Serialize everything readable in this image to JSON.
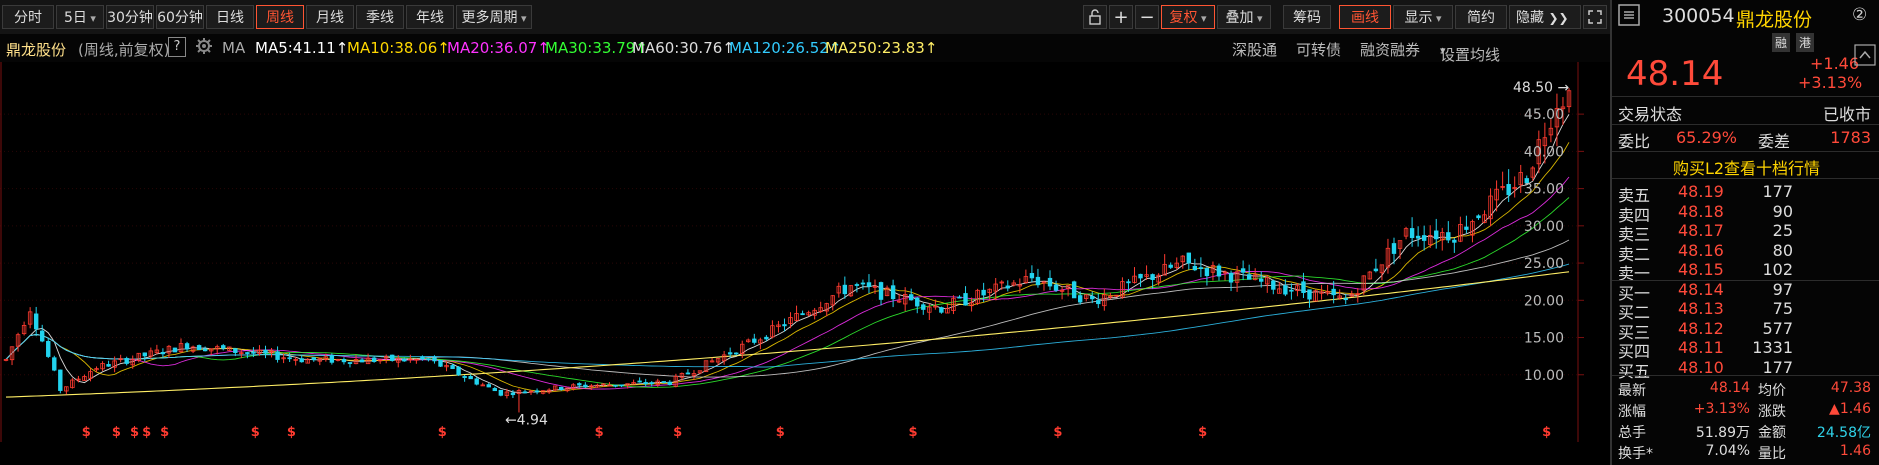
{
  "toolbar": {
    "periods": [
      {
        "label": "分时",
        "active": false
      },
      {
        "label": "5日",
        "active": false,
        "dropdown": true
      },
      {
        "label": "30分钟",
        "active": false
      },
      {
        "label": "60分钟",
        "active": false
      },
      {
        "label": "日线",
        "active": false
      },
      {
        "label": "周线",
        "active": true
      },
      {
        "label": "月线",
        "active": false
      },
      {
        "label": "季线",
        "active": false
      },
      {
        "label": "年线",
        "active": false
      },
      {
        "label": "更多周期",
        "active": false,
        "dropdown": true
      }
    ],
    "fuquan_label": "复权",
    "diejia_label": "叠加",
    "chouma_label": "筹码",
    "huaxian_label": "画线",
    "xianshi_label": "显示",
    "jianyue_label": "简约",
    "yincang_label": "隐藏"
  },
  "ma_bar": {
    "stock_name": "鼎龙股份",
    "period_info": "(周线,前复权)",
    "help": "?",
    "ma_label": "MA",
    "items": [
      {
        "text": "MA5:41.11",
        "color": "#ffffff"
      },
      {
        "text": "MA10:38.06",
        "color": "#ffd700"
      },
      {
        "text": "MA20:36.07",
        "color": "#ff33ff"
      },
      {
        "text": "MA30:33.79",
        "color": "#33ff33"
      },
      {
        "text": "MA60:30.76",
        "color": "#dddddd"
      },
      {
        "text": "MA120:26.52",
        "color": "#33ccff"
      },
      {
        "text": "MA250:23.83",
        "color": "#ffee66"
      }
    ],
    "links": [
      "深股通",
      "可转债",
      "融资融券",
      "设置均线"
    ]
  },
  "chart_data": {
    "type": "candlestick",
    "period": "weekly",
    "ylim": [
      5,
      52
    ],
    "y_ticks": [
      10.0,
      15.0,
      20.0,
      25.0,
      30.0,
      35.0,
      40.0,
      45.0
    ],
    "y_tick_labels": [
      "10.00",
      "15.00",
      "20.00",
      "25.00",
      "30.00",
      "35.00",
      "40.00",
      "45.00"
    ],
    "high_label": "48.50",
    "low_label": "4.94",
    "weeks": 260,
    "close_trend": [
      [
        0,
        12
      ],
      [
        4,
        19
      ],
      [
        9,
        8
      ],
      [
        15,
        11
      ],
      [
        30,
        14
      ],
      [
        50,
        12
      ],
      [
        70,
        12
      ],
      [
        82,
        7.5
      ],
      [
        95,
        8.5
      ],
      [
        110,
        9
      ],
      [
        125,
        15
      ],
      [
        140,
        22
      ],
      [
        155,
        19
      ],
      [
        170,
        23
      ],
      [
        180,
        20
      ],
      [
        195,
        25
      ],
      [
        210,
        22
      ],
      [
        222,
        20
      ],
      [
        232,
        29
      ],
      [
        240,
        29
      ],
      [
        252,
        37
      ],
      [
        257,
        47
      ],
      [
        259,
        48.14
      ]
    ],
    "ma250_start": 7.0,
    "ma250_end": 23.83,
    "dividend_marker_weeks": [
      7,
      12,
      15,
      17,
      20,
      35,
      41,
      66,
      92,
      105,
      122,
      144,
      168,
      192,
      249
    ]
  },
  "panel": {
    "code": "300054",
    "name": "鼎龙股份",
    "badge_circle": "②",
    "tags": [
      "融",
      "港"
    ],
    "price": "48.14",
    "change": "+1.46",
    "change_pct": "+3.13%",
    "trade_status_label": "交易状态",
    "trade_status": "已收市",
    "weibi_label": "委比",
    "weibi": "65.29%",
    "weicha_label": "委差",
    "weicha": "1783",
    "l2_link": "购买L2查看十档行情",
    "asks": [
      {
        "label": "卖五",
        "price": "48.19",
        "vol": "177"
      },
      {
        "label": "卖四",
        "price": "48.18",
        "vol": "90"
      },
      {
        "label": "卖三",
        "price": "48.17",
        "vol": "25"
      },
      {
        "label": "卖二",
        "price": "48.16",
        "vol": "80"
      },
      {
        "label": "卖一",
        "price": "48.15",
        "vol": "102"
      }
    ],
    "bids": [
      {
        "label": "买一",
        "price": "48.14",
        "vol": "97"
      },
      {
        "label": "买二",
        "price": "48.13",
        "vol": "75"
      },
      {
        "label": "买三",
        "price": "48.12",
        "vol": "577"
      },
      {
        "label": "买四",
        "price": "48.11",
        "vol": "1331"
      },
      {
        "label": "买五",
        "price": "48.10",
        "vol": "177"
      }
    ],
    "stats": {
      "zuixin_label": "最新",
      "zuixin": "48.14",
      "junjia_label": "均价",
      "junjia": "47.38",
      "zhangfu_label": "涨幅",
      "zhangfu": "+3.13%",
      "zhangdie_label": "涨跌",
      "zhangdie": "▲1.46",
      "zongshou_label": "总手",
      "zongshou": "51.89万",
      "jine_label": "金额",
      "jine": "24.58亿",
      "huanshou_label": "换手*",
      "huanshou": "7.04%",
      "liangbi_label": "量比",
      "liangbi": "1.46"
    }
  },
  "colors": {
    "up": "#ff3b30",
    "down": "#22d3ee",
    "accent": "#ff5533"
  }
}
